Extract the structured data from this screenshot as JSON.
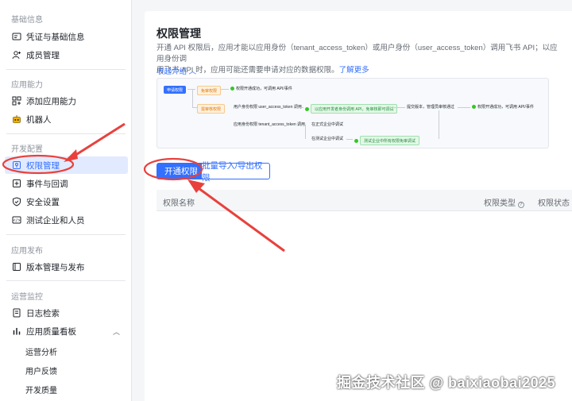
{
  "sidebar": {
    "groups": [
      {
        "title": "基础信息",
        "items": [
          {
            "label": "凭证与基础信息",
            "icon": "id-card-icon"
          },
          {
            "label": "成员管理",
            "icon": "user-add-icon"
          }
        ]
      },
      {
        "title": "应用能力",
        "items": [
          {
            "label": "添加应用能力",
            "icon": "apps-add-icon"
          },
          {
            "label": "机器人",
            "icon": "robot-icon"
          }
        ]
      },
      {
        "title": "开发配置",
        "items": [
          {
            "label": "权限管理",
            "icon": "key-icon",
            "active": true
          },
          {
            "label": "事件与回调",
            "icon": "event-icon"
          },
          {
            "label": "安全设置",
            "icon": "shield-icon"
          },
          {
            "label": "测试企业和人员",
            "icon": "test-icon"
          }
        ]
      },
      {
        "title": "应用发布",
        "items": [
          {
            "label": "版本管理与发布",
            "icon": "version-icon"
          }
        ]
      },
      {
        "title": "运营监控",
        "items": [
          {
            "label": "日志检索",
            "icon": "log-icon"
          },
          {
            "label": "应用质量看板",
            "icon": "chart-icon",
            "expanded": true
          }
        ]
      }
    ],
    "subitems": [
      "运营分析",
      "用户反馈",
      "开发质量"
    ]
  },
  "main": {
    "title": "权限管理",
    "desc_line1": "开通 API 权限后，应用才能以应用身份（tenant_access_token）或用户身份（user_access_token）调用飞书 API；以应用身份调",
    "desc_line2": "用飞书 API 时，应用可能还需要申请对应的数据权限。",
    "learn_more": "了解更多",
    "collapse": "收起介绍",
    "diagram": {
      "apply": "申请权限",
      "no_review": "免审权限",
      "needs_review": "需审核权限",
      "success": "权限开通成功，可调用 API/事件",
      "user_token": "用户身份权限 user_access_token 调用",
      "app_token": "应用身份权限 tenant_access_token 调用",
      "debug": "以应用开发者身份调用 API，免审核即可调试",
      "submit": "提交版本，管理员审核通过",
      "success2": "权限开通成功，可调用 API/事件",
      "formal": "在正式企业中调试",
      "test_ent": "在测试企业中调试",
      "test_free": "测试企业中所有权限免审调试"
    },
    "enable_button": "开通权限",
    "batch_button": "批量导入/导出权限",
    "columns": {
      "name": "权限名称",
      "type": "权限类型",
      "status": "权限状态"
    }
  },
  "watermark": "掘金技术社区 @ baixiaobai2025",
  "colors": {
    "accent": "#3370ff",
    "annotation": "#e8413d"
  }
}
